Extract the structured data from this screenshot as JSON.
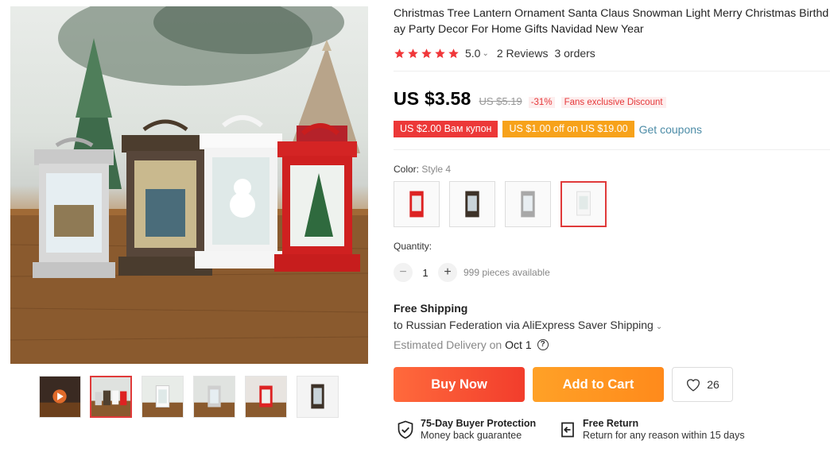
{
  "product": {
    "title": "Christmas Tree Lantern Ornament Santa Claus Snowman Light Merry Christmas Birthday Party Decor For Home Gifts Navidad New Year"
  },
  "rating": {
    "stars": 5,
    "value": "5.0",
    "reviews": "2 Reviews",
    "orders": "3 orders"
  },
  "price": {
    "current": "US $3.58",
    "original": "US $5.19",
    "discount": "-31%",
    "badge": "Fans exclusive Discount"
  },
  "coupons": {
    "items": [
      "US $2.00 Вам купон",
      "US $1.00 off on US $19.00"
    ],
    "get_label": "Get coupons"
  },
  "color": {
    "label": "Color:",
    "selected": "Style 4",
    "options": [
      "red-lantern",
      "bronze-lantern",
      "silver-lantern",
      "white-lantern"
    ]
  },
  "quantity": {
    "label": "Quantity:",
    "value": "1",
    "minus": "−",
    "plus": "+",
    "available": "999 pieces available"
  },
  "shipping": {
    "title": "Free Shipping",
    "destination": "to Russian Federation via AliExpress Saver Shipping",
    "estimate_label": "Estimated Delivery on",
    "estimate_date": "Oct 1"
  },
  "actions": {
    "buy_now": "Buy Now",
    "add_to_cart": "Add to Cart",
    "wishlist_count": "26"
  },
  "services": [
    {
      "title": "75-Day Buyer Protection",
      "subtitle": "Money back guarantee"
    },
    {
      "title": "Free Return",
      "subtitle": "Return for any reason within 15 days"
    }
  ],
  "gallery": {
    "thumbnails": [
      "video-thumbnail",
      "four-lanterns",
      "white-lantern",
      "silver-lantern",
      "red-lantern",
      "bronze-lantern"
    ],
    "active_thumbnail": 1
  },
  "colors": {
    "accent_red": "#e6383a",
    "buy_now": "#f23d2c",
    "add_to_cart": "#ff8a1b",
    "coupon_red": "#ec3838",
    "coupon_orange": "#f7a21a",
    "link": "#4c8ca7"
  }
}
